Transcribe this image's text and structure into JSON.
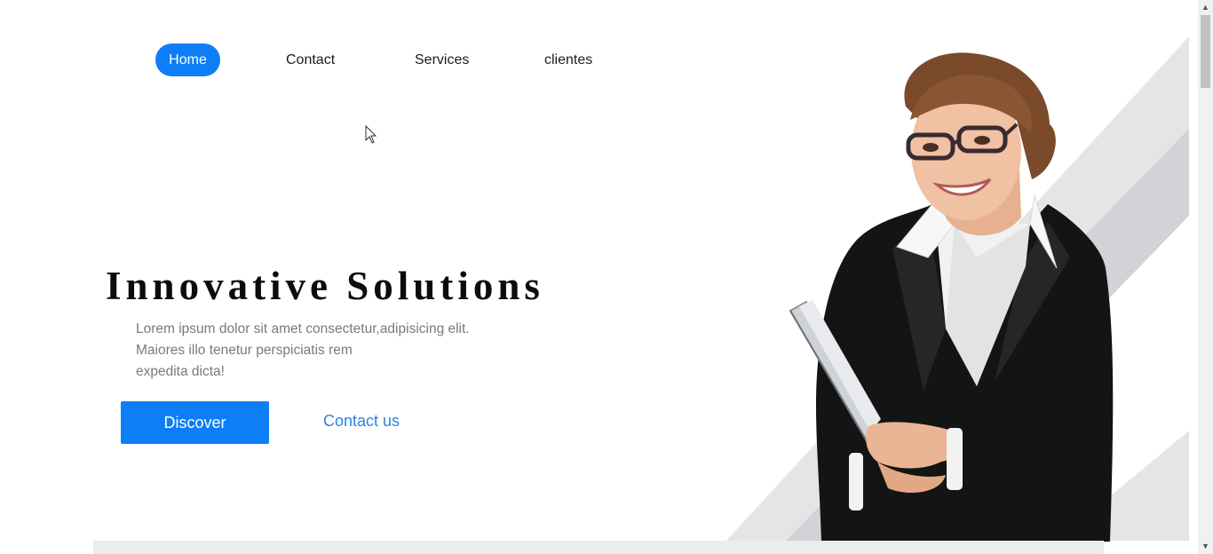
{
  "nav": {
    "items": [
      {
        "label": "Home",
        "active": true
      },
      {
        "label": "Contact",
        "active": false
      },
      {
        "label": "Services",
        "active": false
      },
      {
        "label": "clientes",
        "active": false
      }
    ]
  },
  "hero": {
    "title": "Innovative Solutions",
    "description_lines": [
      "Lorem ipsum dolor sit amet consectetur,adipisicing elit.",
      "Maiores illo tenetur perspiciatis rem",
      "expedita dicta!"
    ],
    "primary_button": "Discover",
    "secondary_link": "Contact us",
    "image_icon": "businesswoman-photo"
  },
  "colors": {
    "accent": "#0d7ef5",
    "link": "#2b82e6",
    "title": "#0c0c0c",
    "body_text": "#7a7a7a",
    "stripe_light": "#e4e5e7",
    "stripe_dark": "#d2d3d6",
    "band": "#ececec"
  },
  "scrollbar": {
    "up_icon": "scroll-up-arrow-icon",
    "down_icon": "scroll-down-arrow-icon"
  }
}
